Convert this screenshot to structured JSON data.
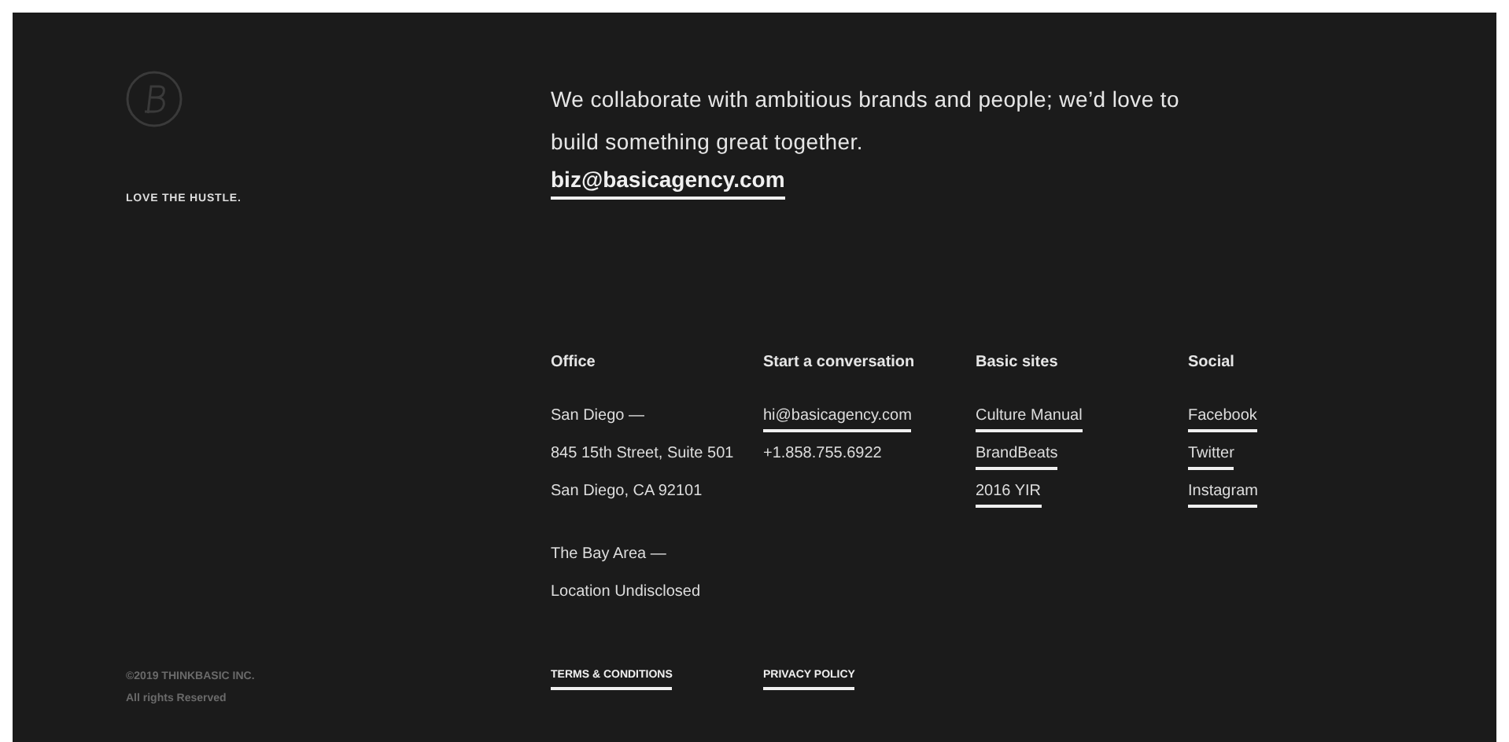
{
  "tagline": "LOVE THE HUSTLE.",
  "intro": "We collaborate with ambitious brands and people; we’d love to build something great together.",
  "contact_email": "biz@basicagency.com",
  "columns": [
    {
      "heading": "Office",
      "groups": [
        [
          {
            "text": "San Diego —",
            "link": false
          },
          {
            "text": "845 15th Street, Suite 501",
            "link": false
          },
          {
            "text": "San Diego, CA 92101",
            "link": false
          }
        ],
        [
          {
            "text": "The Bay Area —",
            "link": false
          },
          {
            "text": "Location Undisclosed",
            "link": false
          }
        ]
      ]
    },
    {
      "heading": "Start a conversation",
      "groups": [
        [
          {
            "text": "hi@basicagency.com",
            "link": true
          },
          {
            "text": "+1.858.755.6922",
            "link": false
          }
        ]
      ]
    },
    {
      "heading": "Basic sites",
      "groups": [
        [
          {
            "text": "Culture Manual",
            "link": true
          },
          {
            "text": "BrandBeats",
            "link": true
          },
          {
            "text": "2016 YIR",
            "link": true
          }
        ]
      ]
    },
    {
      "heading": "Social",
      "groups": [
        [
          {
            "text": "Facebook",
            "link": true
          },
          {
            "text": "Twitter",
            "link": true
          },
          {
            "text": "Instagram",
            "link": true
          }
        ]
      ]
    }
  ],
  "copyright": [
    "©2019 THINKBASIC INC.",
    "All rights Reserved"
  ],
  "legal_links": [
    "TERMS & CONDITIONS",
    "PRIVACY POLICY"
  ]
}
